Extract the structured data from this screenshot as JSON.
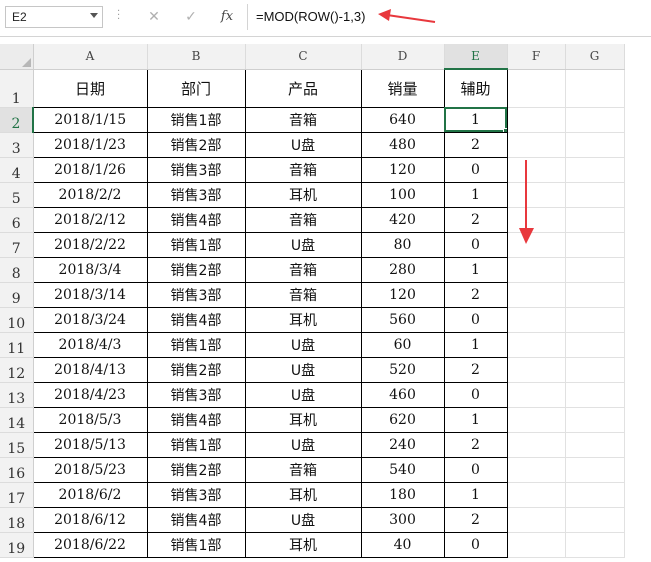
{
  "name_box": {
    "value": "E2"
  },
  "formula_bar": {
    "cancel_glyph": "✕",
    "enter_glyph": "✓",
    "insert_function_label": "fx",
    "formula": "=MOD(ROW()-1,3)"
  },
  "columns": [
    "A",
    "B",
    "C",
    "D",
    "E",
    "F",
    "G"
  ],
  "header_labels": [
    "日期",
    "部门",
    "产品",
    "销量",
    "辅助"
  ],
  "rows": [
    [
      "2018/1/15",
      "销售1部",
      "音箱",
      "640",
      "1"
    ],
    [
      "2018/1/23",
      "销售2部",
      "U盘",
      "480",
      "2"
    ],
    [
      "2018/1/26",
      "销售3部",
      "音箱",
      "120",
      "0"
    ],
    [
      "2018/2/2",
      "销售3部",
      "耳机",
      "100",
      "1"
    ],
    [
      "2018/2/12",
      "销售4部",
      "音箱",
      "420",
      "2"
    ],
    [
      "2018/2/22",
      "销售1部",
      "U盘",
      "80",
      "0"
    ],
    [
      "2018/3/4",
      "销售2部",
      "音箱",
      "280",
      "1"
    ],
    [
      "2018/3/14",
      "销售3部",
      "音箱",
      "120",
      "2"
    ],
    [
      "2018/3/24",
      "销售4部",
      "耳机",
      "560",
      "0"
    ],
    [
      "2018/4/3",
      "销售1部",
      "U盘",
      "60",
      "1"
    ],
    [
      "2018/4/13",
      "销售2部",
      "U盘",
      "520",
      "2"
    ],
    [
      "2018/4/23",
      "销售3部",
      "U盘",
      "460",
      "0"
    ],
    [
      "2018/5/3",
      "销售4部",
      "耳机",
      "620",
      "1"
    ],
    [
      "2018/5/13",
      "销售1部",
      "U盘",
      "240",
      "2"
    ],
    [
      "2018/5/23",
      "销售2部",
      "音箱",
      "540",
      "0"
    ],
    [
      "2018/6/2",
      "销售3部",
      "耳机",
      "180",
      "1"
    ],
    [
      "2018/6/12",
      "销售4部",
      "U盘",
      "300",
      "2"
    ],
    [
      "2018/6/22",
      "销售1部",
      "耳机",
      "40",
      "0"
    ]
  ],
  "active_cell": {
    "column": "E",
    "row": 2
  },
  "colors": {
    "accent": "#217346",
    "annotation_arrow": "#e8383d"
  }
}
